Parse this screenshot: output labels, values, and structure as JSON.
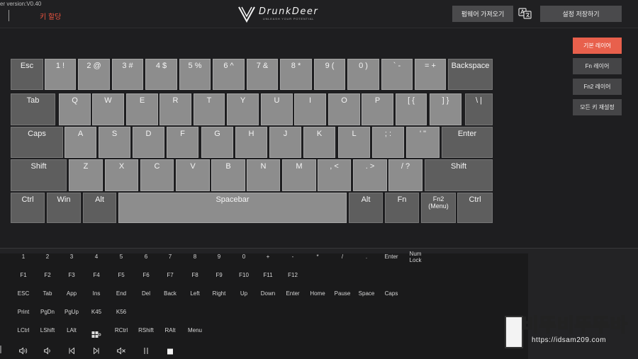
{
  "header": {
    "version": "er version:V0.40",
    "keymap_tab": "키 할당",
    "logo_text": "DrunkDeer",
    "logo_tagline": "UNLEASH YOUR POTENTIAL",
    "import_firmware": "펌웨어 가져오기",
    "save_settings": "설정 저장하기"
  },
  "keyboard": {
    "rows": [
      [
        {
          "label": "Esc",
          "name": "esc"
        },
        {
          "label": "1 !",
          "name": "1"
        },
        {
          "label": "2 @",
          "name": "2"
        },
        {
          "label": "3 #",
          "name": "3"
        },
        {
          "label": "4 $",
          "name": "4"
        },
        {
          "label": "5 %",
          "name": "5"
        },
        {
          "label": "6 ^",
          "name": "6"
        },
        {
          "label": "7 &",
          "name": "7"
        },
        {
          "label": "8 *",
          "name": "8"
        },
        {
          "label": "9 (",
          "name": "9"
        },
        {
          "label": "0 )",
          "name": "0"
        },
        {
          "label": "` -",
          "name": "minus"
        },
        {
          "label": "= +",
          "name": "equal"
        },
        {
          "label": "Backspace",
          "name": "backspace"
        }
      ],
      [
        {
          "label": "Tab",
          "name": "tab"
        },
        {
          "label": "Q",
          "name": "q"
        },
        {
          "label": "W",
          "name": "w"
        },
        {
          "label": "E",
          "name": "e"
        },
        {
          "label": "R",
          "name": "r"
        },
        {
          "label": "T",
          "name": "t"
        },
        {
          "label": "Y",
          "name": "y"
        },
        {
          "label": "U",
          "name": "u"
        },
        {
          "label": "I",
          "name": "i"
        },
        {
          "label": "O",
          "name": "o"
        },
        {
          "label": "P",
          "name": "p"
        },
        {
          "label": "[ {",
          "name": "lbracket"
        },
        {
          "label": "] }",
          "name": "rbracket"
        },
        {
          "label": "\\ |",
          "name": "backslash"
        }
      ],
      [
        {
          "label": "Caps",
          "name": "caps"
        },
        {
          "label": "A",
          "name": "a"
        },
        {
          "label": "S",
          "name": "s"
        },
        {
          "label": "D",
          "name": "d"
        },
        {
          "label": "F",
          "name": "f"
        },
        {
          "label": "G",
          "name": "g"
        },
        {
          "label": "H",
          "name": "h"
        },
        {
          "label": "J",
          "name": "j"
        },
        {
          "label": "K",
          "name": "k"
        },
        {
          "label": "L",
          "name": "l"
        },
        {
          "label": "; :",
          "name": "semicolon"
        },
        {
          "label": "' \"",
          "name": "quote"
        },
        {
          "label": "Enter",
          "name": "enter"
        }
      ],
      [
        {
          "label": "Shift",
          "name": "lshift"
        },
        {
          "label": "Z",
          "name": "z"
        },
        {
          "label": "X",
          "name": "x"
        },
        {
          "label": "C",
          "name": "c"
        },
        {
          "label": "V",
          "name": "v"
        },
        {
          "label": "B",
          "name": "b"
        },
        {
          "label": "N",
          "name": "n"
        },
        {
          "label": "M",
          "name": "m"
        },
        {
          "label": ", <",
          "name": "comma"
        },
        {
          "label": ". >",
          "name": "period"
        },
        {
          "label": "/ ?",
          "name": "slash"
        },
        {
          "label": "Shift",
          "name": "rshift"
        }
      ],
      [
        {
          "label": "Ctrl",
          "name": "lctrl"
        },
        {
          "label": "Win",
          "name": "win"
        },
        {
          "label": "Alt",
          "name": "lalt"
        },
        {
          "label": "Spacebar",
          "name": "spacebar"
        },
        {
          "label": "Alt",
          "name": "ralt"
        },
        {
          "label": "Fn",
          "name": "fn"
        },
        {
          "label": "Fn2\n(Menu)",
          "name": "fn2"
        },
        {
          "label": "Ctrl",
          "name": "rctrl"
        }
      ]
    ]
  },
  "layers": {
    "base": "기본 레이어",
    "fn": "Fn 레이어",
    "fn2": "Fn2 레이어",
    "reset": "모든 키 재설정"
  },
  "palette": {
    "rows": [
      [
        "1",
        "2",
        "3",
        "4",
        "5",
        "6",
        "7",
        "8",
        "9",
        "0",
        "+",
        "-",
        "*",
        "/",
        ".",
        "Enter",
        "Num\nLock"
      ],
      [
        "F1",
        "F2",
        "F3",
        "F4",
        "F5",
        "F6",
        "F7",
        "F8",
        "F9",
        "F10",
        "F11",
        "F12"
      ],
      [
        "ESC",
        "Tab",
        "App",
        "Ins",
        "End",
        "Del",
        "Back",
        "Left",
        "Right",
        "Up",
        "Down",
        "Enter",
        "Home",
        "Pause",
        "Space",
        "Caps"
      ],
      [
        "Print",
        "PgDn",
        "PgUp",
        "K45",
        "K56"
      ],
      [
        "LCtrl",
        "LShift",
        "LAlt",
        "",
        "RCtrl",
        "RShift",
        "RAlt",
        "Menu"
      ],
      [
        "",
        "",
        "",
        "",
        "",
        "",
        "",
        ""
      ]
    ],
    "icons": [
      "windows-icon",
      "volume-up-icon",
      "volume-down-icon",
      "previous-track-icon",
      "next-track-icon",
      "mute-icon",
      "play-pause-icon",
      "stop-icon"
    ]
  },
  "watermark": {
    "title": "비뚜비뚜뚜바",
    "url": "https://idsam209.com"
  },
  "colors": {
    "accent": "#e8604c",
    "key": "#8d8d8d",
    "modifier_key": "#5e5e5e",
    "background": "#232325"
  }
}
